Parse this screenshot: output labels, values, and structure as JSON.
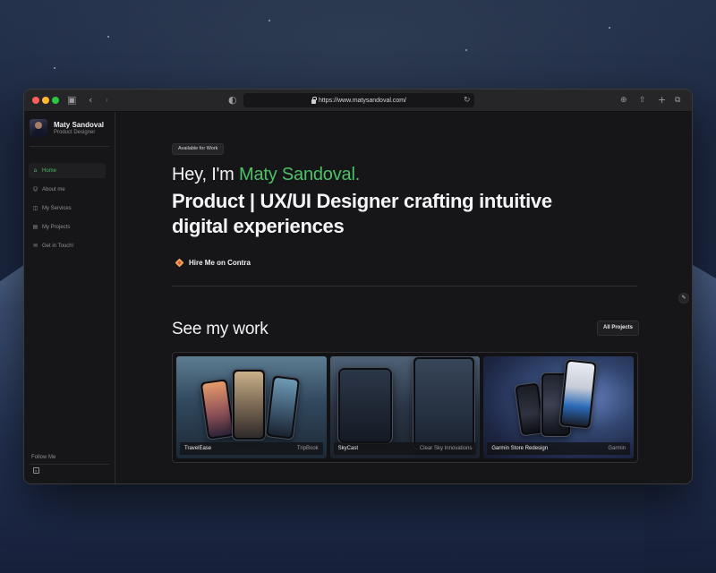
{
  "browser": {
    "url": "https://www.matysandoval.com/"
  },
  "sidebar": {
    "name": "Maty Sandoval",
    "role": "Product Designer",
    "items": [
      {
        "label": "Home",
        "icon": "home-icon",
        "active": true
      },
      {
        "label": "About me",
        "icon": "user-icon",
        "active": false
      },
      {
        "label": "My Services",
        "icon": "services-icon",
        "active": false
      },
      {
        "label": "My Projects",
        "icon": "projects-icon",
        "active": false
      },
      {
        "label": "Get in Touch!",
        "icon": "mail-icon",
        "active": false
      }
    ],
    "follow_label": "Follow Me"
  },
  "hero": {
    "badge": "Available for Work",
    "greeting": "Hey, I'm ",
    "name_highlight": "Maty Sandoval.",
    "headline": "Product | UX/UI Designer crafting intuitive digital experiences",
    "hire_label": "Hire Me on Contra"
  },
  "work": {
    "title": "See my work",
    "all_button": "All Projects",
    "projects": [
      {
        "title": "TravelEase",
        "client": "TripBook"
      },
      {
        "title": "SkyCast",
        "client": "Clear Sky Innovations"
      },
      {
        "title": "Garmin Store Redesign",
        "client": "Garmin"
      }
    ]
  },
  "colors": {
    "accent": "#4cc168",
    "background": "#161517"
  }
}
